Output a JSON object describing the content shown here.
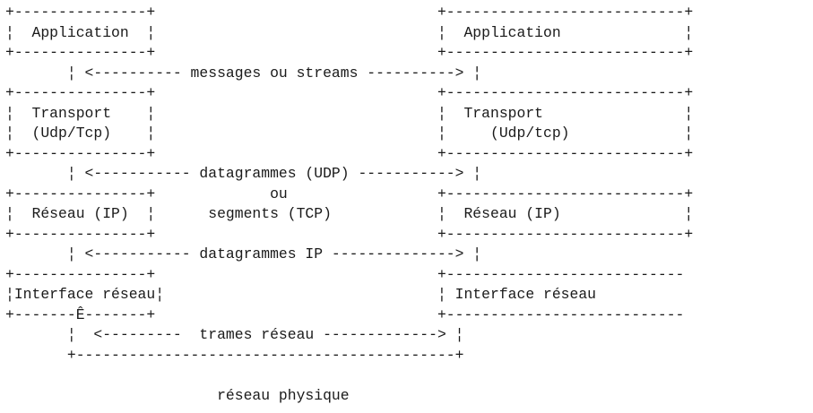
{
  "diagram": {
    "lines": [
      "+---------------+                                +---------------------------+",
      "¦  Application  ¦                                ¦  Application              ¦",
      "+---------------+                                +---------------------------+",
      "       ¦ <---------- messages ou streams ----------> ¦",
      "+---------------+                                +---------------------------+",
      "¦  Transport    ¦                                ¦  Transport                ¦",
      "¦  (Udp/Tcp)    ¦                                ¦     (Udp/tcp)             ¦",
      "+---------------+                                +---------------------------+",
      "       ¦ <----------- datagrammes (UDP) -----------> ¦",
      "+---------------+             ou                 +---------------------------+",
      "¦  Réseau (IP)  ¦      segments (TCP)            ¦  Réseau (IP)              ¦",
      "+---------------+                                +---------------------------+",
      "       ¦ <----------- datagrammes IP --------------> ¦",
      "+---------------+                                +---------------------------",
      "¦Interface réseau¦                               ¦ Interface réseau",
      "+-------Ê-------+                                +---------------------------",
      "       ¦  <---------  trames réseau -------------> ¦",
      "       +-------------------------------------------+",
      "",
      "                        réseau physique"
    ]
  }
}
